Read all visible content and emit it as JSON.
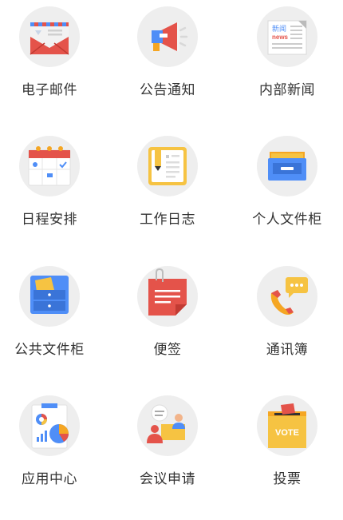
{
  "apps": [
    {
      "label": "电子邮件",
      "icon": "mail-icon"
    },
    {
      "label": "公告通知",
      "icon": "megaphone-icon"
    },
    {
      "label": "内部新闻",
      "icon": "newspaper-icon",
      "icon_text": [
        "新闻",
        "news"
      ]
    },
    {
      "label": "日程安排",
      "icon": "calendar-icon"
    },
    {
      "label": "工作日志",
      "icon": "worklog-notebook-icon"
    },
    {
      "label": "个人文件柜",
      "icon": "file-cabinet-icon"
    },
    {
      "label": "公共文件柜",
      "icon": "public-file-cabinet-icon"
    },
    {
      "label": "便签",
      "icon": "sticky-note-icon"
    },
    {
      "label": "通讯簿",
      "icon": "phone-chat-icon"
    },
    {
      "label": "应用中心",
      "icon": "app-center-chart-icon"
    },
    {
      "label": "会议申请",
      "icon": "meeting-icon"
    },
    {
      "label": "投票",
      "icon": "vote-box-icon",
      "icon_text": [
        "VOTE"
      ]
    }
  ],
  "colors": {
    "circle_bg": "#eeeeee",
    "label": "#333333",
    "red": "#e4534a",
    "blue": "#4f8ef7",
    "orange": "#f5a623",
    "yellow": "#f6c342"
  }
}
